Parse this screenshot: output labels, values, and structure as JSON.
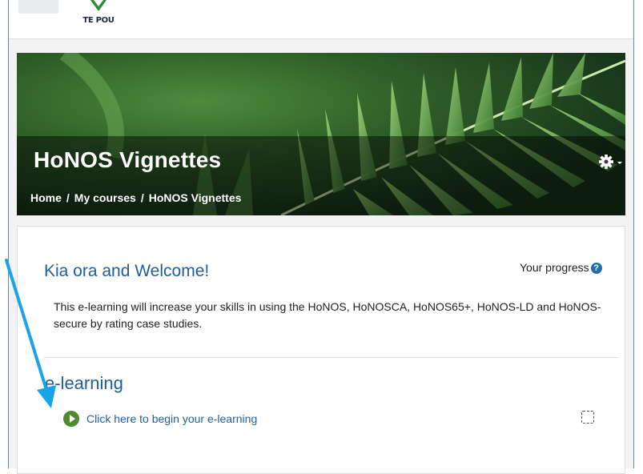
{
  "header": {
    "logo_text": "TE POU"
  },
  "course": {
    "title": "HoNOS Vignettes",
    "breadcrumb": [
      "Home",
      "My courses",
      "HoNOS Vignettes"
    ],
    "breadcrumb_separator": "/"
  },
  "summary": {
    "heading": "Kia ora and Welcome!",
    "progress_label": "Your progress",
    "description": "This e-learning will increase your skills in using the HoNOS, HoNOSCA, HoNOS65+, HoNOS-LD and HoNOS-secure by rating case studies."
  },
  "section": {
    "title": "e-learning",
    "activity_label": "Click here to begin your e-learning",
    "activity_icon": "play-icon",
    "completion_checked": false
  },
  "colors": {
    "link": "#1f5e9c",
    "activity_icon": "#4f8a2e",
    "annotation_arrow": "#1aa3e8",
    "help_icon": "#1f6fb0"
  }
}
